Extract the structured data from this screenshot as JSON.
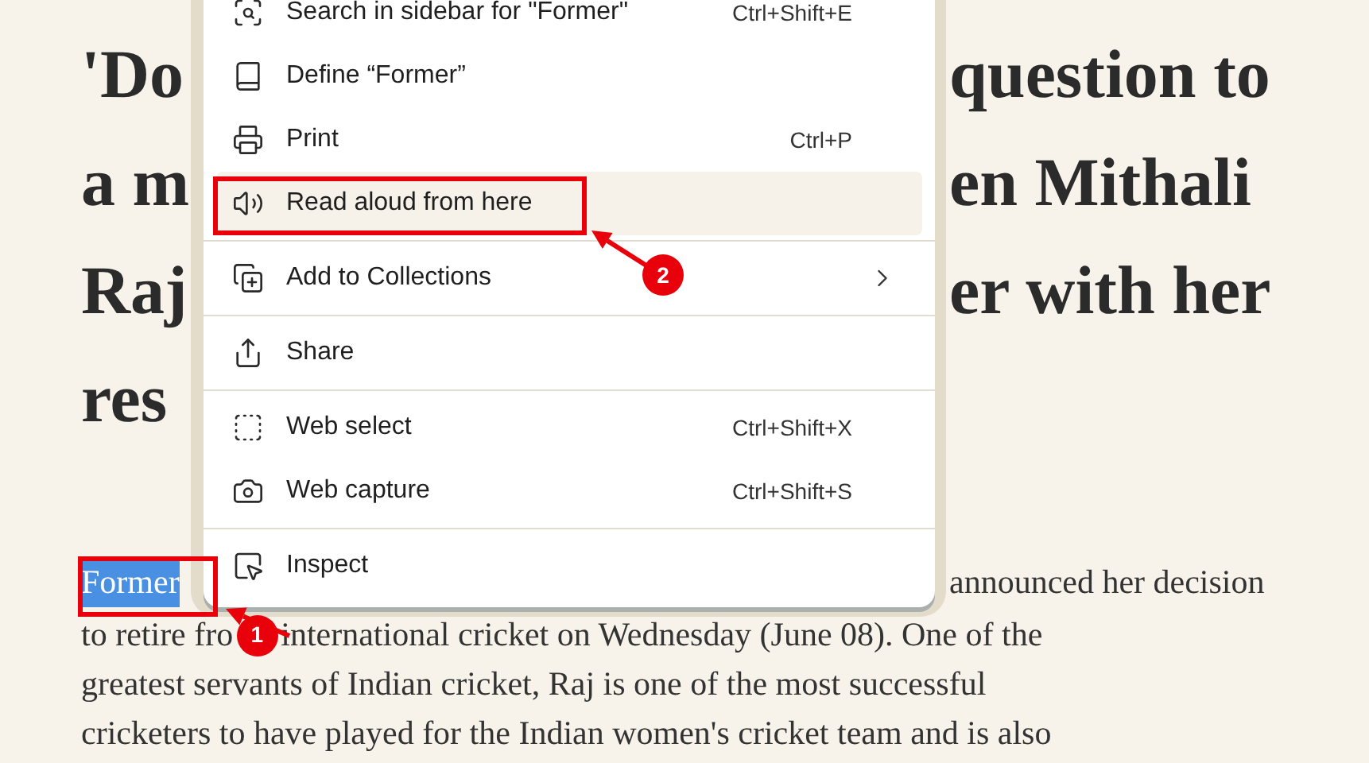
{
  "article": {
    "headline_left": [
      "'Do",
      "a m",
      "Raj",
      "res"
    ],
    "headline_right": [
      "question to",
      "en Mithali",
      "er with her"
    ],
    "first_line": {
      "selection": {
        "text": "Former",
        "selected": true
      },
      "rest": "announced her decision"
    },
    "line_2": {
      "before": "to retire fro",
      "after": "international cricket on Wednesday (June 08). One of the"
    },
    "lines": [
      "greatest servants of Indian cricket, Raj is one of the most successful",
      "cricketers to have played for the Indian women's cricket team and is also"
    ]
  },
  "context_menu": {
    "items": [
      {
        "kind": "item",
        "label": "Search in sidebar for \"Former\"",
        "shortcut": "Ctrl+Shift+E",
        "highlighted": false
      },
      {
        "kind": "item",
        "label": "Define “Former”",
        "highlighted": false
      },
      {
        "kind": "item",
        "label": "Print",
        "shortcut": "Ctrl+P",
        "highlighted": false
      },
      {
        "kind": "item",
        "label": "Read aloud from here",
        "highlighted": true
      },
      {
        "kind": "divider"
      },
      {
        "kind": "submenu",
        "label": "Add to Collections",
        "highlighted": false
      },
      {
        "kind": "divider"
      },
      {
        "kind": "item",
        "label": "Share",
        "highlighted": false
      },
      {
        "kind": "divider"
      },
      {
        "kind": "item",
        "label": "Web select",
        "shortcut": "Ctrl+Shift+X",
        "highlighted": false
      },
      {
        "kind": "item",
        "label": "Web capture",
        "shortcut": "Ctrl+Shift+S",
        "highlighted": false
      },
      {
        "kind": "divider"
      },
      {
        "kind": "item",
        "label": "Inspect",
        "highlighted": false
      }
    ]
  },
  "annotations": [
    {
      "label": "1"
    },
    {
      "label": "2"
    }
  ]
}
